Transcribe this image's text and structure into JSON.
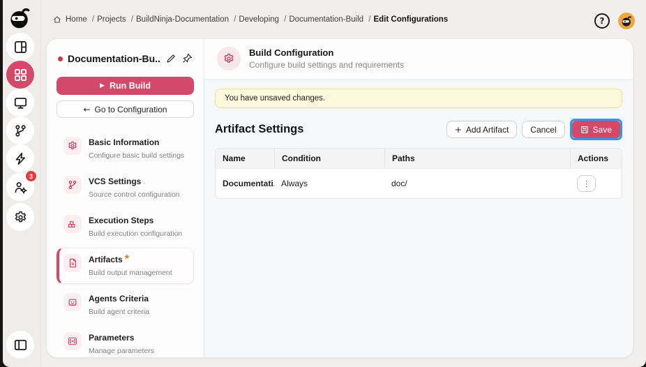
{
  "colors": {
    "accent": "#d4496a",
    "focus_highlight": "#2b9ce8",
    "badge": "#e23c3c",
    "avatar_bg": "#f0a63c",
    "banner_bg": "#fcf8dc",
    "banner_border": "#eadfa6"
  },
  "icons": {
    "play": "▶",
    "back_arrow": "←",
    "plus": "+",
    "ellipsis": "⋮",
    "help": "?"
  },
  "rail": {
    "badge_count": "3",
    "items": [
      "ninja-logo",
      "dashboard",
      "apps-grid",
      "monitor",
      "git-branch",
      "bolt",
      "agents",
      "settings",
      "panel-toggle"
    ]
  },
  "breadcrumb": [
    "Home",
    "Projects",
    "BuildNinja-Documentation",
    "Developing",
    "Documentation-Build",
    "Edit Configurations"
  ],
  "left_panel": {
    "title": "Documentation-Bu...",
    "run_build": "Run Build",
    "goto_configuration": "Go to Configuration",
    "nav": [
      {
        "label": "Basic Information",
        "sub": "Configure basic build settings"
      },
      {
        "label": "VCS Settings",
        "sub": "Source control configuration"
      },
      {
        "label": "Execution Steps",
        "sub": "Build execution configuration"
      },
      {
        "label": "Artifacts",
        "sub": "Build output management",
        "required": "*"
      },
      {
        "label": "Agents Criteria",
        "sub": "Build agent criteria"
      },
      {
        "label": "Parameters",
        "sub": "Manage parameters"
      }
    ]
  },
  "main": {
    "header": {
      "title": "Build Configuration",
      "subtitle": "Configure build settings and requirements"
    },
    "banner": "You have unsaved changes.",
    "section_title": "Artifact Settings",
    "add_artifact": "Add Artifact",
    "cancel": "Cancel",
    "save": "Save",
    "table": {
      "headers": [
        "Name",
        "Condition",
        "Paths",
        "Actions"
      ],
      "rows": [
        {
          "name": "Documentati...",
          "condition": "Always",
          "paths": "doc/"
        }
      ]
    }
  }
}
